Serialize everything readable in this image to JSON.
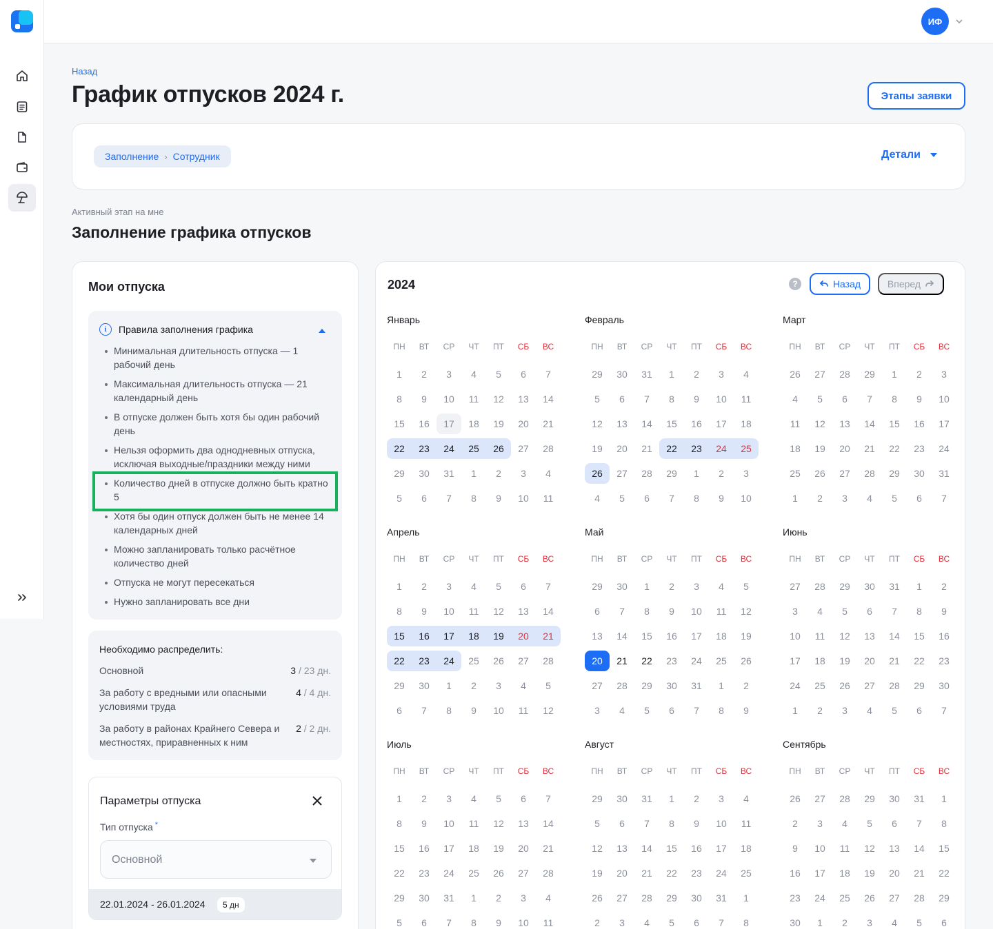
{
  "header": {
    "avatar_initials": "ИФ"
  },
  "page": {
    "back_link": "Назад",
    "title": "График отпусков 2024 г.",
    "stages_button": "Этапы заявки",
    "breadcrumbs": [
      "Заполнение",
      "Сотрудник"
    ],
    "details_label": "Детали",
    "active_stage_label": "Активный этап на мне",
    "section_title": "Заполнение графика отпусков"
  },
  "my_vacations": {
    "title": "Мои отпуска",
    "rules_title": "Правила заполнения графика",
    "rules": [
      "Минимальная длительность отпуска — 1 рабочий день",
      "Максимальная длительность отпуска — 21 календарный день",
      "В отпуске должен быть хотя бы один рабочий день",
      "Нельзя оформить два однодневных отпуска, исключая выходные/праздники между ними",
      "Количество дней в отпуске должно быть кратно 5",
      "Хотя бы один отпуск должен быть не менее 14 календарных дней",
      "Можно запланировать только расчётное количество дней",
      "Отпуска не могут пересекаться",
      "Нужно запланировать все дни"
    ],
    "distribute_title": "Необходимо распределить:",
    "distribute": [
      {
        "name": "Основной",
        "left": "3",
        "total": " / 23 дн."
      },
      {
        "name": "За работу с вредными или опасными условиями труда",
        "left": "4",
        "total": " / 4 дн."
      },
      {
        "name": "За работу в районах Крайнего Севера и местностях, приравненных к ним",
        "left": "2",
        "total": " / 2 дн."
      }
    ],
    "params_title": "Параметры отпуска",
    "type_label": "Тип отпуска",
    "required_mark": "*",
    "type_value": "Основной",
    "range": "22.01.2024 - 26.01.2024",
    "range_badge": "5 дн"
  },
  "calendar": {
    "year": "2024",
    "help": "?",
    "back_label": "Назад",
    "forward_label": "Вперед",
    "weekdays": [
      "ПН",
      "ВТ",
      "СР",
      "ЧТ",
      "ПТ",
      "СБ",
      "ВС"
    ],
    "months": [
      {
        "name": "Январь",
        "start": 1,
        "days": 31,
        "prev_days": 31,
        "selected": [
          [
            22,
            26
          ]
        ],
        "today": 17
      },
      {
        "name": "Февраль",
        "start": 4,
        "days": 29,
        "prev_days": 31,
        "selected": [
          [
            22,
            25
          ],
          [
            26,
            26
          ]
        ]
      },
      {
        "name": "Март",
        "start": 5,
        "days": 31,
        "prev_days": 29,
        "selected": []
      },
      {
        "name": "Апрель",
        "start": 1,
        "days": 30,
        "prev_days": 31,
        "selected": [
          [
            15,
            21
          ],
          [
            22,
            24
          ]
        ]
      },
      {
        "name": "Май",
        "start": 3,
        "days": 31,
        "prev_days": 30,
        "selected": [],
        "chosen": 20,
        "current_range": [
          21,
          22
        ]
      },
      {
        "name": "Июнь",
        "start": 6,
        "days": 30,
        "prev_days": 31,
        "selected": []
      },
      {
        "name": "Июль",
        "start": 1,
        "days": 31,
        "prev_days": 30,
        "selected": []
      },
      {
        "name": "Август",
        "start": 4,
        "days": 31,
        "prev_days": 31,
        "selected": []
      },
      {
        "name": "Сентябрь",
        "start": 7,
        "days": 30,
        "prev_days": 31,
        "selected": []
      }
    ]
  },
  "colors": {
    "accent": "#1d6ef5",
    "weekend": "#e0303b",
    "selected": "#dbe6fb",
    "highlight": "#17b15d"
  },
  "sidebar_icons": [
    "home-icon",
    "document-list-icon",
    "file-icon",
    "wallet-icon",
    "beach-umbrella-icon",
    "expand-icon"
  ]
}
